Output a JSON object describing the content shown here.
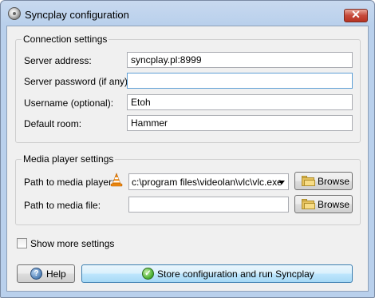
{
  "window": {
    "title": "Syncplay configuration",
    "close_glyph": "✕"
  },
  "connection": {
    "legend": "Connection settings",
    "server_address": {
      "label": "Server address:",
      "value": "syncplay.pl:8999"
    },
    "server_password": {
      "label": "Server password (if any):",
      "value": ""
    },
    "username": {
      "label": "Username (optional):",
      "value": "Etoh"
    },
    "default_room": {
      "label": "Default room:",
      "value": "Hammer"
    }
  },
  "media": {
    "legend": "Media player settings",
    "player_path": {
      "label": "Path to media player:",
      "value": "c:\\program files\\videolan\\vlc\\vlc.exe",
      "icon": "vlc-cone-icon"
    },
    "file_path": {
      "label": "Path to media file:",
      "value": ""
    },
    "browse_label": "Browse"
  },
  "more_settings": {
    "label": "Show more settings",
    "checked": false
  },
  "footer": {
    "help_label": "Help",
    "store_label": "Store configuration and run Syncplay"
  },
  "colors": {
    "title_bar": "#b9d0ec",
    "close_button": "#c6493a",
    "focus_border": "#5fa0d6"
  }
}
